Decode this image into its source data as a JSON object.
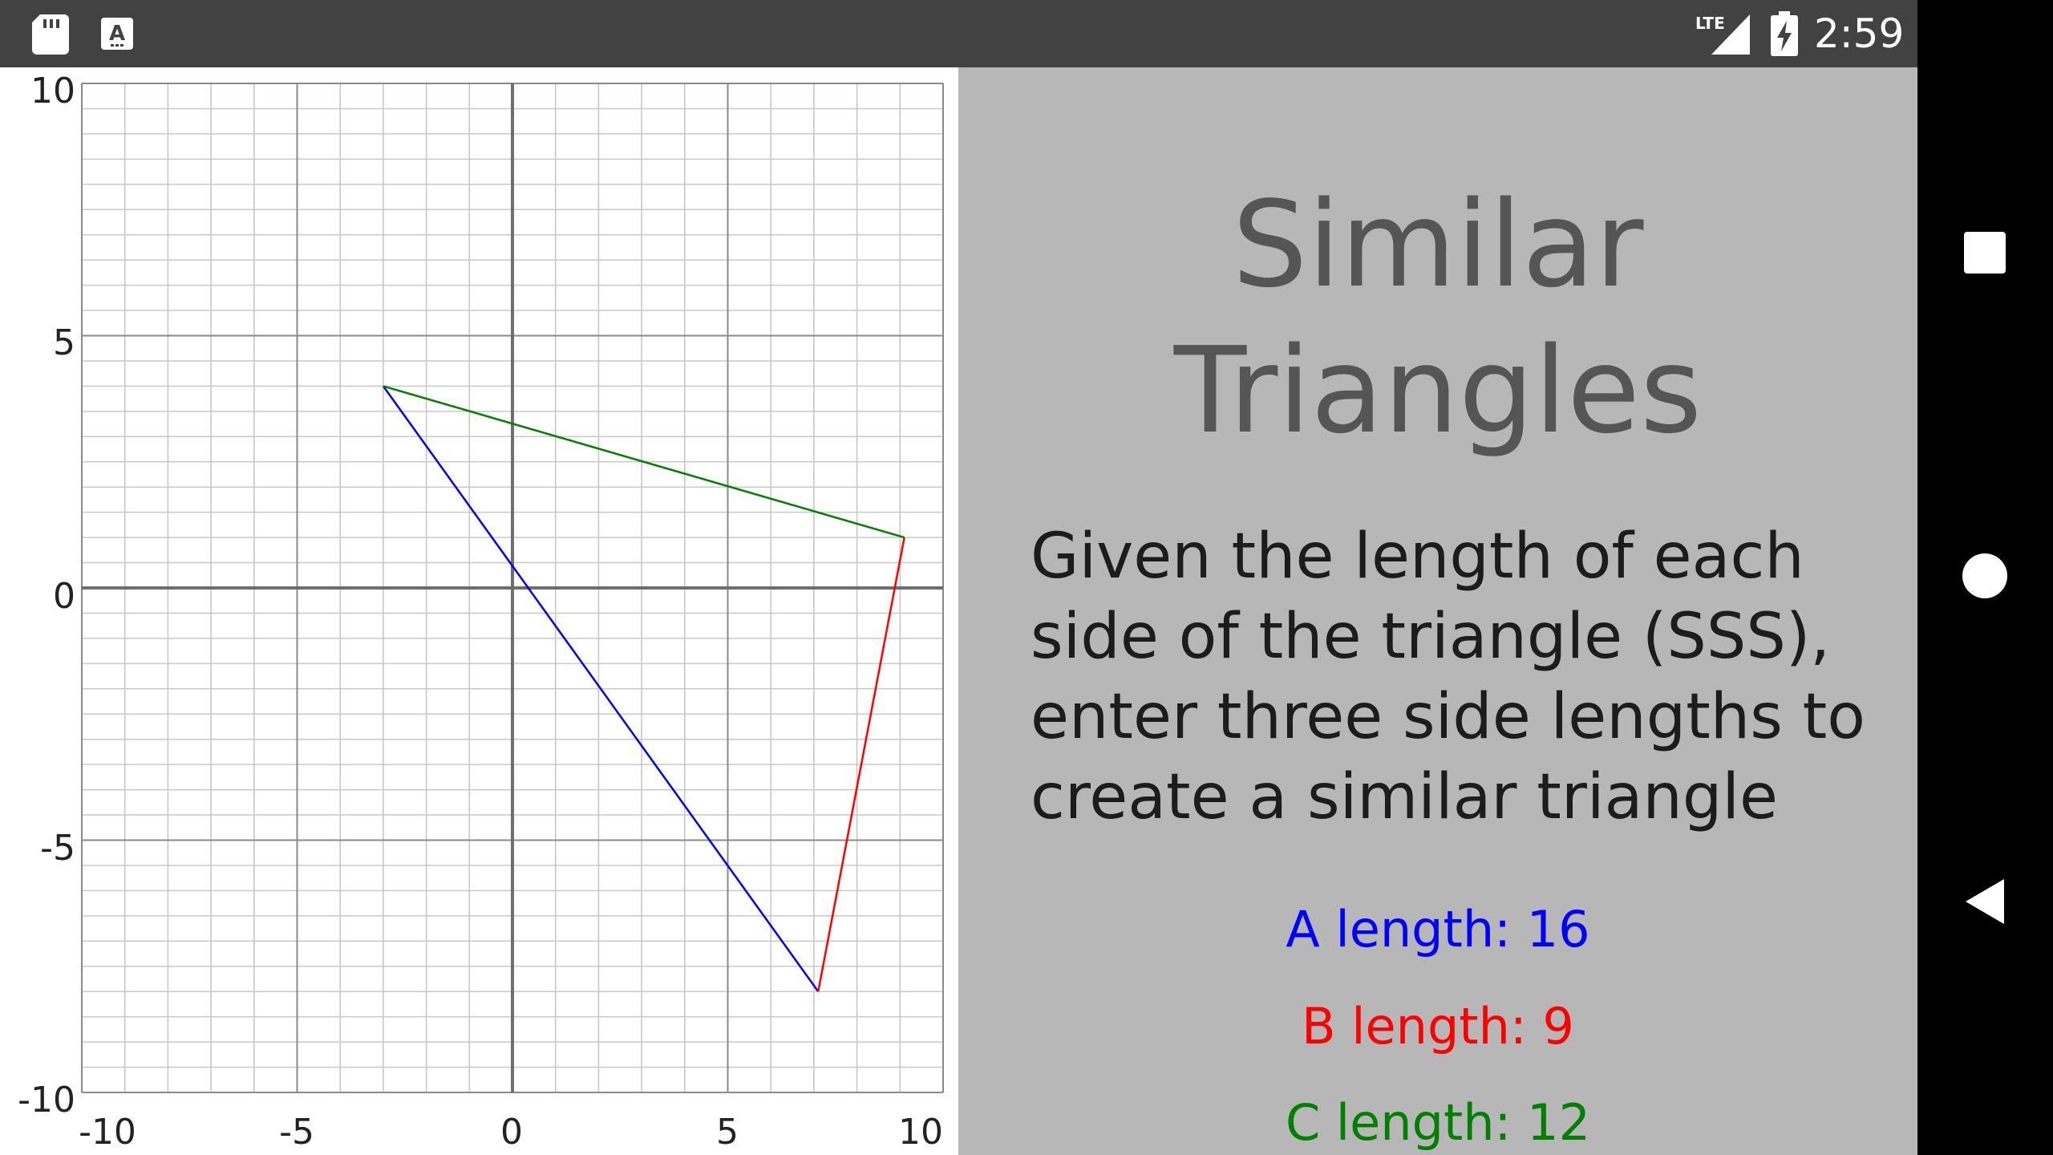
{
  "status_bar": {
    "time": "2:59",
    "network": "LTE",
    "icons": [
      "sd-card-icon",
      "keyboard-icon",
      "lte-signal-icon",
      "battery-charging-icon"
    ]
  },
  "graph": {
    "x_ticks": [
      "-10",
      "-5",
      "0",
      "5",
      "10"
    ],
    "y_ticks": [
      "10",
      "5",
      "0",
      "-5",
      "-10"
    ],
    "range": {
      "xmin": -10,
      "xmax": 10,
      "ymin": -10,
      "ymax": 10
    },
    "grid": true,
    "vertices": {
      "p1": [
        -3,
        4
      ],
      "p2": [
        9.1,
        1
      ],
      "p3": [
        7.1,
        -8
      ]
    },
    "sides": [
      {
        "name": "A",
        "from": "p1",
        "to": "p3",
        "color": "#0000ff"
      },
      {
        "name": "B",
        "from": "p3",
        "to": "p2",
        "color": "#ff0000"
      },
      {
        "name": "C",
        "from": "p1",
        "to": "p2",
        "color": "#008000"
      }
    ]
  },
  "info": {
    "title_line1": "Similar",
    "title_line2": "Triangles",
    "description": "Given the length of each side of the triangle (SSS), enter three side lengths to create a similar triangle",
    "a_length": "A length: 16",
    "b_length": "B length: 9",
    "c_length": "C length: 12"
  },
  "colors": {
    "side_a": "#0000ff",
    "side_b": "#ff0000",
    "side_c": "#008000",
    "panel_bg": "#b7b7b7",
    "status_bar": "#424242"
  },
  "nav_bar": {
    "icons": [
      "recents-icon",
      "home-icon",
      "back-icon"
    ]
  }
}
